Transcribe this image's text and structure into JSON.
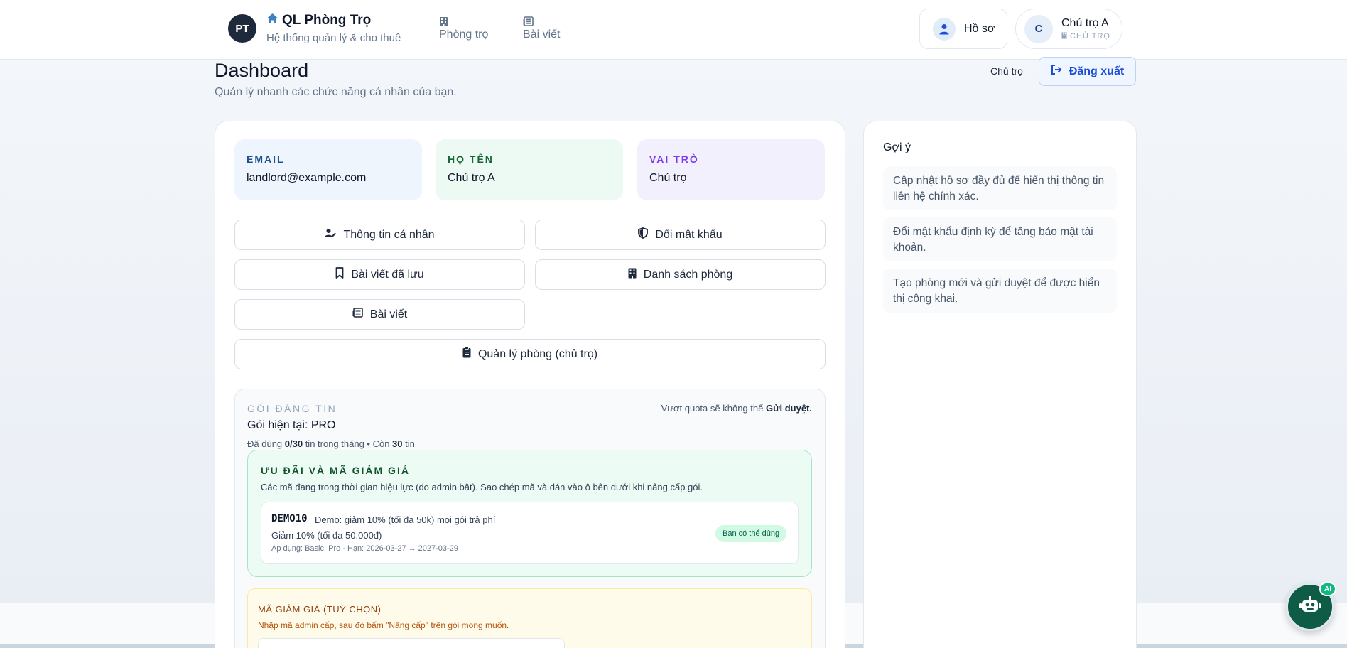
{
  "header": {
    "logo_initials": "PT",
    "brand_title": "QL Phòng Trọ",
    "brand_subtitle": "Hệ thống quản lý & cho thuê",
    "nav": [
      {
        "label": "Phòng trọ",
        "icon": "building-icon"
      },
      {
        "label": "Bài viết",
        "icon": "newspaper-icon"
      }
    ],
    "profile_label": "Hồ sơ",
    "user": {
      "initial": "C",
      "name": "Chủ trọ A",
      "role": "CHỦ TRỌ"
    }
  },
  "page": {
    "title": "Dashboard",
    "subtitle": "Quản lý nhanh các chức năng cá nhân của bạn.",
    "role_text": "Chủ trọ",
    "logout_label": "Đăng xuất"
  },
  "info": {
    "email_label": "EMAIL",
    "email_value": "landlord@example.com",
    "name_label": "HỌ TÊN",
    "name_value": "Chủ trọ A",
    "role_label": "VAI TRÒ",
    "role_value": "Chủ trọ"
  },
  "actions": {
    "personal_info": "Thông tin cá nhân",
    "change_password": "Đổi mật khẩu",
    "saved_posts": "Bài viết đã lưu",
    "room_list": "Danh sách phòng",
    "posts": "Bài viết",
    "manage_rooms": "Quản lý phòng (chủ trọ)"
  },
  "plan": {
    "label": "GÓI ĐĂNG TIN",
    "current": "Gói hiện tại: PRO",
    "usage_prefix": "Đã dùng ",
    "usage_value": "0/30",
    "usage_mid": " tin trong tháng • Còn ",
    "usage_remaining": "30",
    "usage_suffix": " tin",
    "quota_prefix": "Vượt quota sẽ không thể ",
    "quota_action": "Gửi duyệt."
  },
  "promo": {
    "title": "ƯU ĐÃI VÀ MÃ GIẢM GIÁ",
    "description": "Các mã đang trong thời gian hiệu lực (do admin bật). Sao chép mã và dán vào ô bên dưới khi nâng cấp gói.",
    "coupon": {
      "code": "DEMO10",
      "description": "Demo: giảm 10% (tối đa 50k) mọi gói trả phí",
      "discount": "Giảm 10% (tối đa 50.000đ)",
      "apply": "Áp dụng: Basic, Pro · Hạn: 2026-03-27 → 2027-03-29",
      "badge": "Bạn có thể dùng"
    }
  },
  "discount": {
    "title": "MÃ GIẢM GIÁ (TUỲ CHỌN)",
    "description": "Nhập mã admin cấp, sau đó bấm \"Nâng cấp\" trên gói mong muốn."
  },
  "tips": {
    "title": "Gợi ý",
    "items": [
      "Cập nhật hồ sơ đầy đủ để hiển thị thông tin liên hệ chính xác.",
      "Đổi mật khẩu định kỳ để tăng bảo mật tài khoản.",
      "Tạo phòng mới và gửi duyệt để được hiển thị công khai."
    ]
  },
  "chatbot": {
    "badge": "AI"
  },
  "colors": {
    "primary": "#1d4ed8",
    "dark": "#1e293b",
    "success": "#10b981",
    "chatbot": "#0f5c46"
  }
}
